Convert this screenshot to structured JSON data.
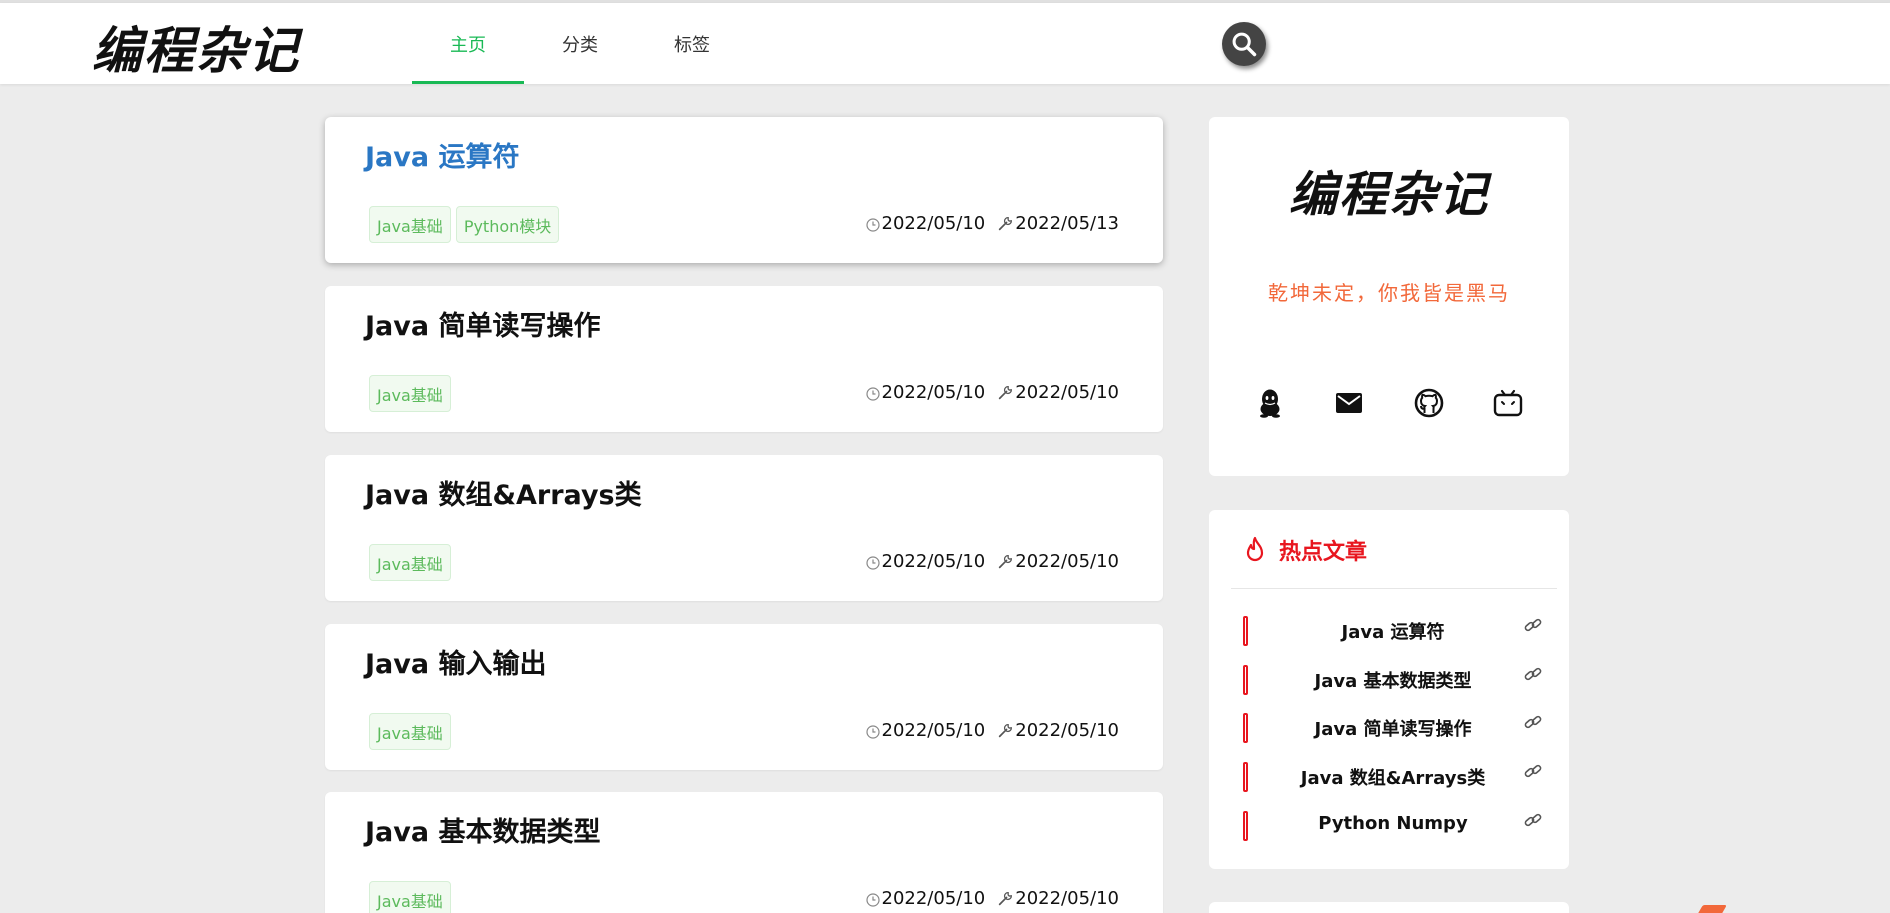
{
  "header": {
    "logo": "编程杂记",
    "nav": [
      {
        "label": "主页",
        "active": true
      },
      {
        "label": "分类",
        "active": false
      },
      {
        "label": "标签",
        "active": false
      }
    ],
    "search_icon": "search-icon"
  },
  "articles": [
    {
      "title": "Java 运算符",
      "tags": [
        "Java基础",
        "Python模块"
      ],
      "created": "2022/05/10",
      "updated": "2022/05/13"
    },
    {
      "title": "Java 简单读写操作",
      "tags": [
        "Java基础"
      ],
      "created": "2022/05/10",
      "updated": "2022/05/10"
    },
    {
      "title": "Java 数组&Arrays类",
      "tags": [
        "Java基础"
      ],
      "created": "2022/05/10",
      "updated": "2022/05/10"
    },
    {
      "title": "Java 输入输出",
      "tags": [
        "Java基础"
      ],
      "created": "2022/05/10",
      "updated": "2022/05/10"
    },
    {
      "title": "Java 基本数据类型",
      "tags": [
        "Java基础"
      ],
      "created": "2022/05/10",
      "updated": "2022/05/10"
    }
  ],
  "profile": {
    "logo": "编程杂记",
    "motto": "乾坤未定，你我皆是黑马",
    "socials": [
      "qq-icon",
      "mail-icon",
      "github-icon",
      "bilibili-icon"
    ]
  },
  "hot": {
    "title": "热点文章",
    "items": [
      {
        "label": "Java 运算符"
      },
      {
        "label": "Java 基本数据类型"
      },
      {
        "label": "Java 简单读写操作"
      },
      {
        "label": "Java 数组&Arrays类"
      },
      {
        "label": "Python Numpy"
      }
    ]
  },
  "colors": {
    "accent_green": "#19b955",
    "link_blue": "#2a77c4",
    "hot_red": "#e8161f",
    "motto_orange": "#f2683a",
    "tag_green": "#5cba5c"
  }
}
